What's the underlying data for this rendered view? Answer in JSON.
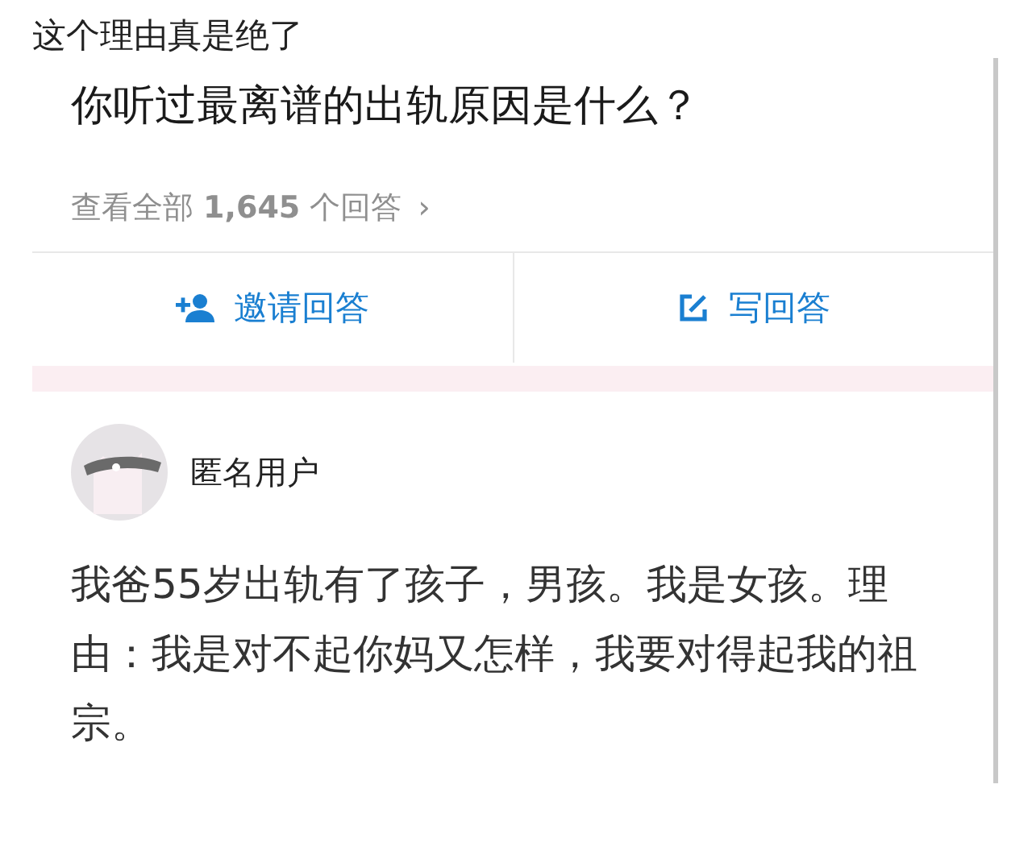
{
  "caption": "这个理由真是绝了",
  "question": {
    "title": "你听过最离谱的出轨原因是什么？"
  },
  "view_all": {
    "prefix": "查看全部",
    "count": "1,645",
    "suffix": "个回答",
    "chevron": "›"
  },
  "actions": [
    {
      "kind": "invite",
      "label": "邀请回答"
    },
    {
      "kind": "write",
      "label": "写回答"
    }
  ],
  "answer": {
    "author": "匿名用户",
    "content": "我爸55岁出轨有了孩子，男孩。我是女孩。理由：我是对不起你妈又怎样，我要对得起我的祖宗。"
  }
}
